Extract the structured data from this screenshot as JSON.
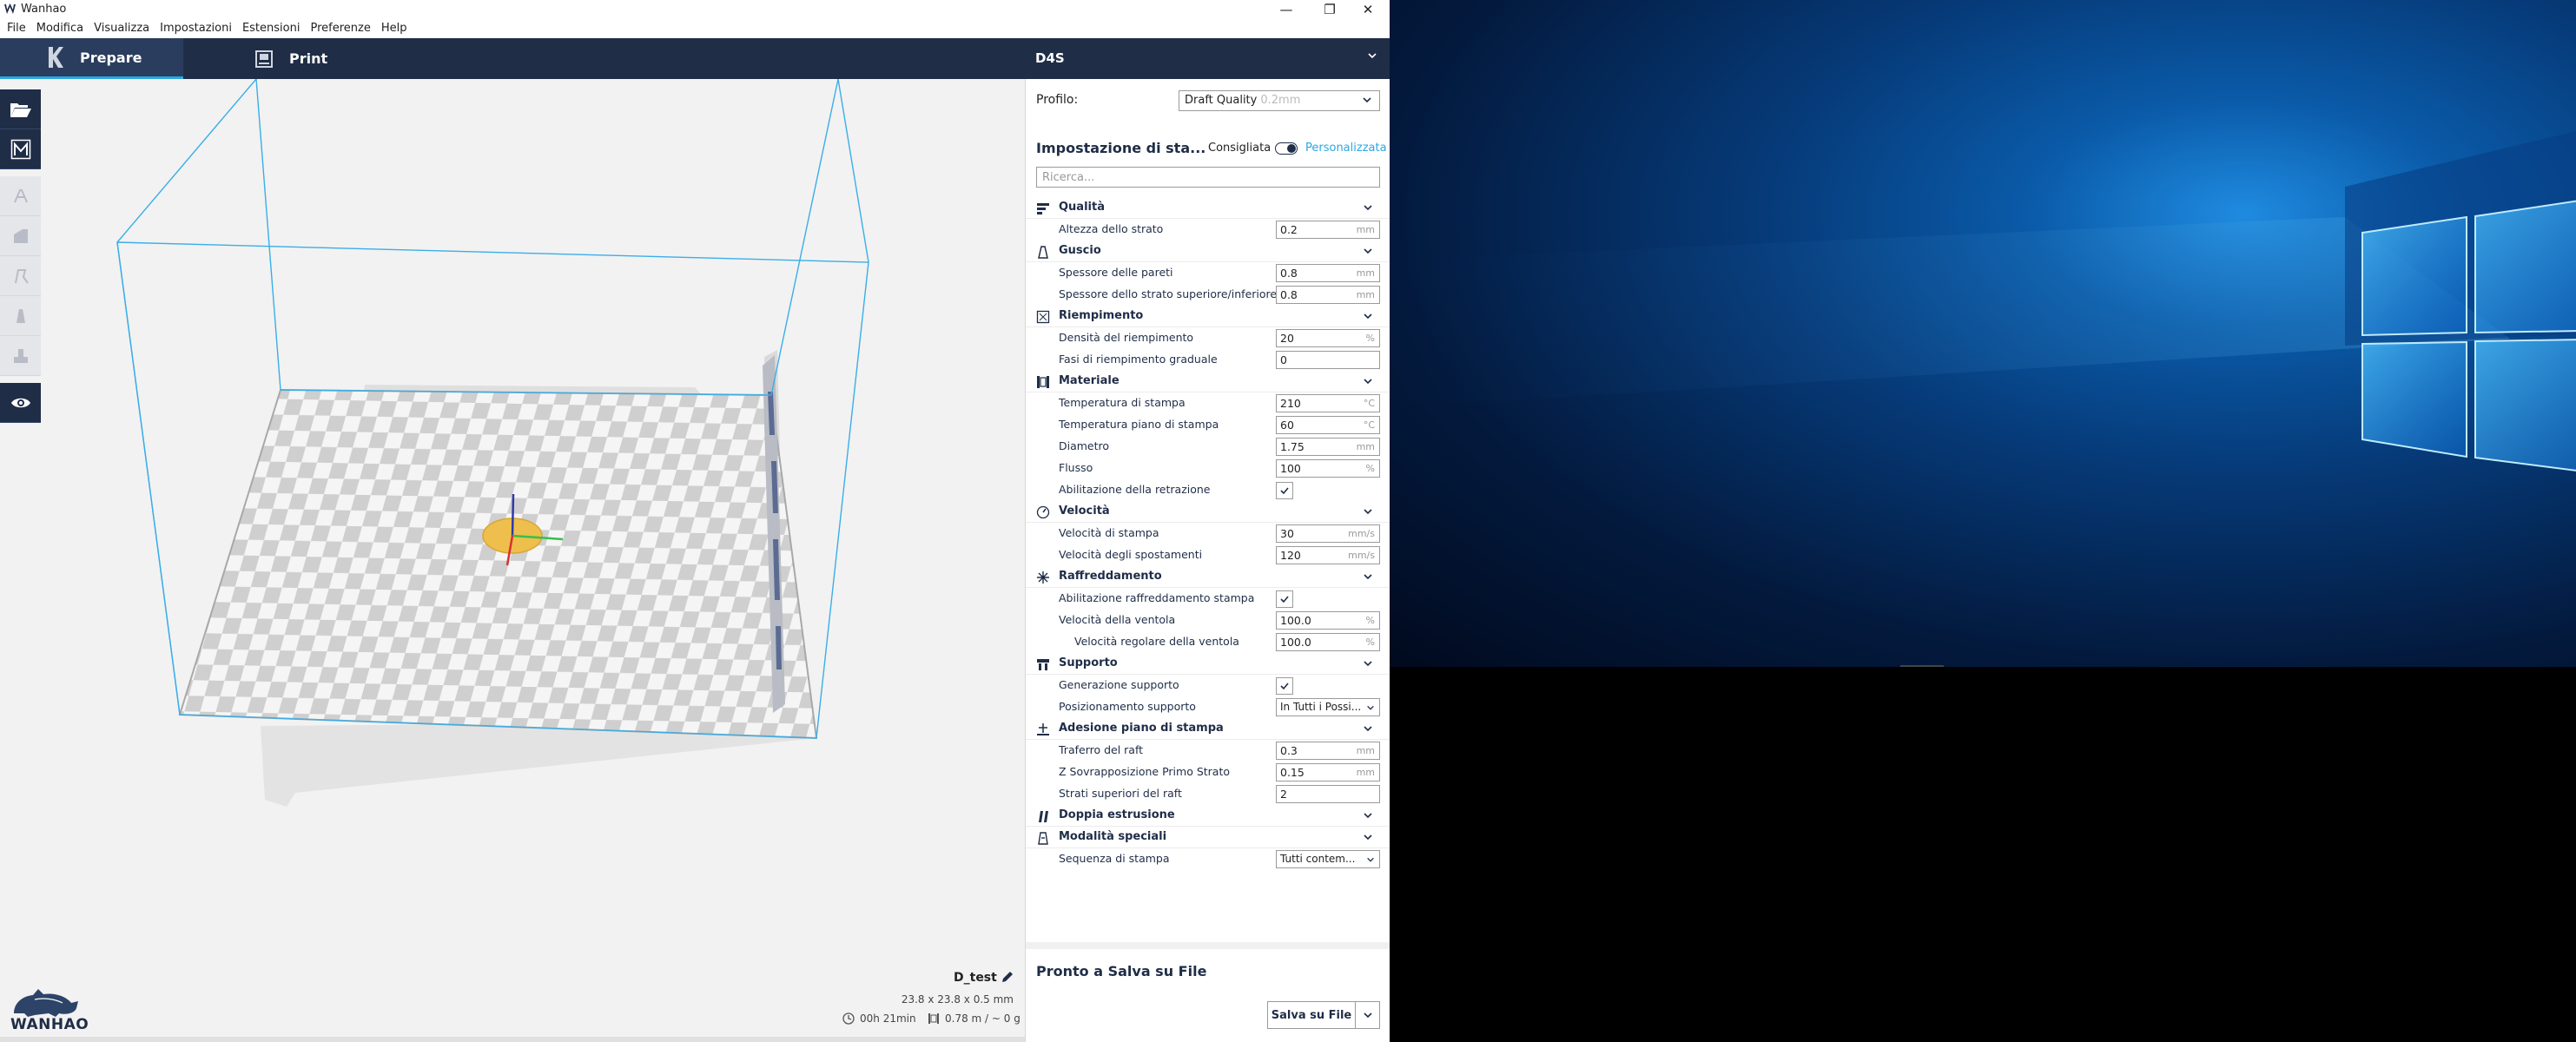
{
  "window": {
    "title": "Wanhao",
    "minimize": "—",
    "restore": "❐",
    "close": "✕"
  },
  "menu": [
    "File",
    "Modifica",
    "Visualizza",
    "Impostazioni",
    "Estensioni",
    "Preferenze",
    "Help"
  ],
  "header": {
    "prepare": "Prepare",
    "print": "Print",
    "machine": "D4S"
  },
  "toolbar": {
    "icons": [
      "open-file-icon",
      "marketplace-icon",
      "move-icon",
      "scale-icon",
      "rotate-icon",
      "mirror-icon",
      "support-blocker-icon",
      "view-icon"
    ]
  },
  "sidebar": {
    "profile_label": "Profilo:",
    "profile_value": "Draft Quality",
    "profile_sub": "0.2mm",
    "settings_title": "Impostazione di sta...",
    "mode_recommended": "Consigliata",
    "mode_custom": "Personalizzata",
    "search_placeholder": "Ricerca...",
    "rows": [
      {
        "kind": "cat",
        "label": "Qualità",
        "icon": "quality-icon"
      },
      {
        "kind": "num",
        "label": "Altezza dello strato",
        "value": "0.2",
        "unit": "mm"
      },
      {
        "kind": "cat",
        "label": "Guscio",
        "icon": "shell-icon"
      },
      {
        "kind": "num",
        "label": "Spessore delle pareti",
        "value": "0.8",
        "unit": "mm"
      },
      {
        "kind": "num",
        "label": "Spessore dello strato superiore/inferiore",
        "value": "0.8",
        "unit": "mm"
      },
      {
        "kind": "cat",
        "label": "Riempimento",
        "icon": "infill-icon"
      },
      {
        "kind": "num",
        "label": "Densità del riempimento",
        "value": "20",
        "unit": "%"
      },
      {
        "kind": "num",
        "label": "Fasi di riempimento graduale",
        "value": "0",
        "unit": ""
      },
      {
        "kind": "cat",
        "label": "Materiale",
        "icon": "material-icon"
      },
      {
        "kind": "num",
        "label": "Temperatura di stampa",
        "value": "210",
        "unit": "°C"
      },
      {
        "kind": "num",
        "label": "Temperatura piano di stampa",
        "value": "60",
        "unit": "°C"
      },
      {
        "kind": "num",
        "label": "Diametro",
        "value": "1.75",
        "unit": "mm"
      },
      {
        "kind": "num",
        "label": "Flusso",
        "value": "100",
        "unit": "%"
      },
      {
        "kind": "check",
        "label": "Abilitazione della retrazione",
        "checked": true
      },
      {
        "kind": "cat",
        "label": "Velocità",
        "icon": "speed-icon"
      },
      {
        "kind": "num",
        "label": "Velocità di stampa",
        "value": "30",
        "unit": "mm/s"
      },
      {
        "kind": "num",
        "label": "Velocità degli spostamenti",
        "value": "120",
        "unit": "mm/s"
      },
      {
        "kind": "cat",
        "label": "Raffreddamento",
        "icon": "cooling-icon"
      },
      {
        "kind": "check",
        "label": "Abilitazione raffreddamento stampa",
        "checked": true
      },
      {
        "kind": "num",
        "label": "Velocità della ventola",
        "value": "100.0",
        "unit": "%"
      },
      {
        "kind": "num",
        "label": "Velocità regolare della ventola",
        "value": "100.0",
        "unit": "%",
        "sub": true
      },
      {
        "kind": "cat",
        "label": "Supporto",
        "icon": "support-icon"
      },
      {
        "kind": "check",
        "label": "Generazione supporto",
        "checked": true
      },
      {
        "kind": "select",
        "label": "Posizionamento supporto",
        "value": "In Tutti i Possi..."
      },
      {
        "kind": "cat",
        "label": "Adesione piano di stampa",
        "icon": "adhesion-icon"
      },
      {
        "kind": "num",
        "label": "Traferro del raft",
        "value": "0.3",
        "unit": "mm"
      },
      {
        "kind": "num",
        "label": "Z Sovrapposizione Primo Strato",
        "value": "0.15",
        "unit": "mm"
      },
      {
        "kind": "num",
        "label": "Strati superiori del raft",
        "value": "2",
        "unit": ""
      },
      {
        "kind": "cat",
        "label": "Doppia estrusione",
        "icon": "dual-extrusion-icon"
      },
      {
        "kind": "cat",
        "label": "Modalità speciali",
        "icon": "special-modes-icon"
      },
      {
        "kind": "select",
        "label": "Sequenza di stampa",
        "value": "Tutti contem..."
      }
    ],
    "ready_label": "Pronto a Salva su File",
    "save_label": "Salva su File"
  },
  "job": {
    "name": "D_test",
    "dimensions": "23.8 x 23.8 x 0.5 mm",
    "time": "00h 21min",
    "material": "0.78 m / ~ 0 g"
  },
  "logo": {
    "text": "WANHAO"
  },
  "colors": {
    "header": "#1f2d47",
    "accent": "#2aa8e0",
    "model": "#f2c24a",
    "build_volume": "#3aaee8"
  }
}
